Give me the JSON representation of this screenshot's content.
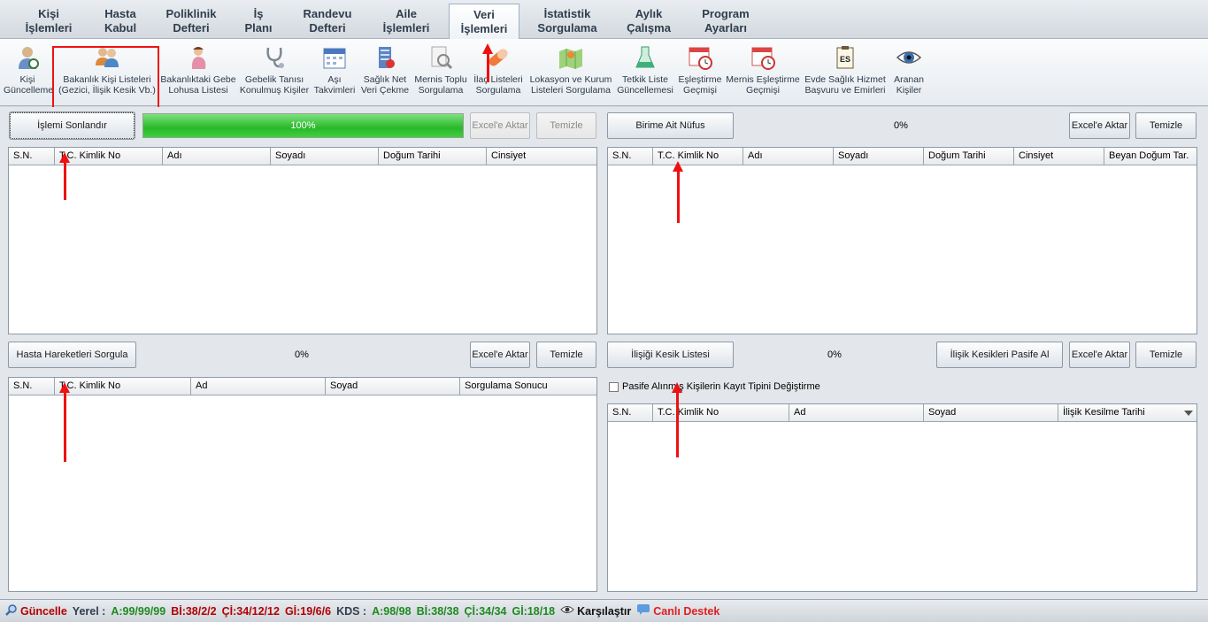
{
  "topmenu": [
    {
      "label": "Kişi\nİşlemleri",
      "active": false
    },
    {
      "label": "Hasta\nKabul",
      "active": false
    },
    {
      "label": "Poliklinik\nDefteri",
      "active": false
    },
    {
      "label": "İş\nPlanı",
      "active": false
    },
    {
      "label": "Randevu\nDefteri",
      "active": false
    },
    {
      "label": "Aile\nİşlemleri",
      "active": false
    },
    {
      "label": "Veri\nİşlemleri",
      "active": true
    },
    {
      "label": "İstatistik\nSorgulama",
      "active": false
    },
    {
      "label": "Aylık\nÇalışma",
      "active": false
    },
    {
      "label": "Program\nAyarları",
      "active": false
    }
  ],
  "ribbon": [
    {
      "l1": "Kişi",
      "l2": "Güncelleme",
      "icon": "person-refresh-icon"
    },
    {
      "l1": "Bakanlık Kişi Listeleri",
      "l2": "(Gezici, İlişik Kesik Vb.)",
      "icon": "people-group-icon"
    },
    {
      "l1": "Bakanlıktaki Gebe",
      "l2": "Lohusa Listesi",
      "icon": "pregnant-woman-icon"
    },
    {
      "l1": "Gebelik Tanısı",
      "l2": "Konulmuş Kişiler",
      "icon": "stethoscope-icon"
    },
    {
      "l1": "Aşı",
      "l2": "Takvimleri",
      "icon": "calendar-icon"
    },
    {
      "l1": "Sağlık Net",
      "l2": "Veri Çekme",
      "icon": "network-download-icon"
    },
    {
      "l1": "Mernis Toplu",
      "l2": "Sorgulama",
      "icon": "document-search-icon"
    },
    {
      "l1": "İlaç Listeleri",
      "l2": "Sorgulama",
      "icon": "pill-icon"
    },
    {
      "l1": "Lokasyon ve Kurum",
      "l2": "Listeleri Sorgulama",
      "icon": "map-pin-icon"
    },
    {
      "l1": "Tetkik Liste",
      "l2": "Güncellemesi",
      "icon": "lab-test-icon"
    },
    {
      "l1": "Eşleştirme",
      "l2": "Geçmişi",
      "icon": "calendar-clock-icon"
    },
    {
      "l1": "Mernis Eşleştirme",
      "l2": "Geçmişi",
      "icon": "calendar-clock-icon"
    },
    {
      "l1": "Evde Sağlık Hizmet",
      "l2": "Başvuru ve Emirleri",
      "icon": "clipboard-es-icon"
    },
    {
      "l1": "Aranan",
      "l2": "Kişiler",
      "icon": "eye-icon"
    }
  ],
  "panel_tl": {
    "main_button": "İşlemi Sonlandır",
    "progress": 1.0,
    "progress_text": "100%",
    "export_button": "Excel'e Aktar",
    "clear_button": "Temizle",
    "columns": [
      "S.N.",
      "T.C. Kimlik No",
      "Adı",
      "Soyadı",
      "Doğum Tarihi",
      "Cinsiyet"
    ]
  },
  "panel_tr": {
    "main_button": "Birime Ait Nüfus",
    "progress_text": "0%",
    "export_button": "Excel'e Aktar",
    "clear_button": "Temizle",
    "columns": [
      "S.N.",
      "T.C. Kimlik No",
      "Adı",
      "Soyadı",
      "Doğum Tarihi",
      "Cinsiyet",
      "Beyan Doğum Tar."
    ]
  },
  "panel_bl": {
    "main_button": "Hasta Hareketleri Sorgula",
    "progress_text": "0%",
    "export_button": "Excel'e Aktar",
    "clear_button": "Temizle",
    "columns": [
      "S.N.",
      "T.C. Kimlik No",
      "Ad",
      "Soyad",
      "Sorgulama Sonucu"
    ]
  },
  "panel_br": {
    "main_button": "İlişiği Kesik Listesi",
    "progress_text": "0%",
    "passive_button": "İlişik Kesikleri Pasife Al",
    "export_button": "Excel'e Aktar",
    "clear_button": "Temizle",
    "checkbox_label": "Pasife Alınmış Kişilerin Kayıt Tipini Değiştirme",
    "columns": [
      "S.N.",
      "T.C. Kimlik No",
      "Ad",
      "Soyad",
      "İlişik Kesilme Tarihi"
    ]
  },
  "status": {
    "update_label": "Güncelle",
    "local_label": "Yerel :",
    "a1": "A:99/99/99",
    "b1": "Bİ:38/2/2",
    "c1": "Çİ:34/12/12",
    "g1": "Gİ:19/6/6",
    "kds_label": "KDS :",
    "a2": "A:98/98",
    "b2": "Bİ:38/38",
    "c2": "Çİ:34/34",
    "g2": "Gİ:18/18",
    "compare_label": "Karşılaştır",
    "support_label": "Canlı Destek"
  },
  "colors": {
    "accent_red": "#e11111",
    "progress_green": "#29b829",
    "status_red": "#b30000",
    "status_green": "#1f8a1f"
  }
}
